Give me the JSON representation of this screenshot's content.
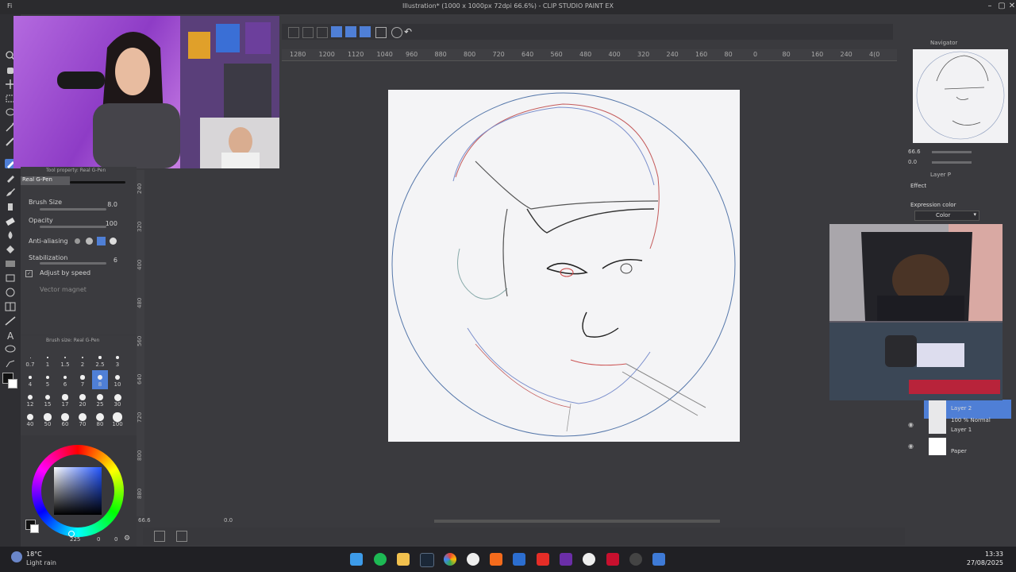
{
  "window": {
    "title": "Illustration* (1000 x 1000px 72dpi 66.6%) - CLIP STUDIO PAINT EX",
    "menu_fi": "Fi"
  },
  "ruler": {
    "top_ticks": [
      "1280",
      "1200",
      "1120",
      "1040",
      "960",
      "880",
      "800",
      "720",
      "640",
      "560",
      "480",
      "400",
      "320",
      "240",
      "160",
      "80",
      "0",
      "80",
      "160",
      "240",
      "4(0"
    ],
    "left_ticks": [
      "240",
      "320",
      "400",
      "480",
      "560",
      "640",
      "720",
      "800",
      "880"
    ]
  },
  "tool_property": {
    "header": "Tool property: Real G-Pen",
    "brush_name": "Real G-Pen",
    "brush_size_label": "Brush Size",
    "brush_size_value": "8.0",
    "opacity_label": "Opacity",
    "opacity_value": "100",
    "antialias_label": "Anti-aliasing",
    "stabilization_label": "Stabilization",
    "stabilization_value": "6",
    "adjust_label": "Adjust by speed",
    "vector_label": "Vector magnet"
  },
  "brush_size_panel": {
    "header": "Brush size: Real G-Pen",
    "sizes": [
      "0.7",
      "1",
      "1.5",
      "2",
      "2.5",
      "3",
      "4",
      "5",
      "6",
      "7",
      "8",
      "10",
      "12",
      "15",
      "17",
      "20",
      "25",
      "30",
      "40",
      "50",
      "60",
      "70",
      "80",
      "100"
    ],
    "selected": "8"
  },
  "color_panel": {
    "values": [
      "225",
      "0",
      "0"
    ]
  },
  "navigator": {
    "title": "Navigator",
    "zoom": "66.6",
    "rotation": "0.0"
  },
  "layer_panel": {
    "title": "Layer P",
    "effect_label": "Effect",
    "expression_label": "Expression color",
    "expression_value": "Color",
    "layers": [
      {
        "name": "Layer 2",
        "mode": ""
      },
      {
        "name": "Layer 1",
        "mode": "100 % Normal"
      },
      {
        "name": "Paper",
        "mode": ""
      }
    ]
  },
  "canvas_status": {
    "zoom": "66.6",
    "angle": "0.0"
  },
  "taskbar": {
    "temperature": "18°C",
    "weather": "Light rain",
    "time": "13:33",
    "date": "27/08/2025"
  },
  "colors": {
    "accent_blue": "#4f7fd6",
    "panel": "#3b3b3f",
    "canvas": "#f4f4f6"
  }
}
